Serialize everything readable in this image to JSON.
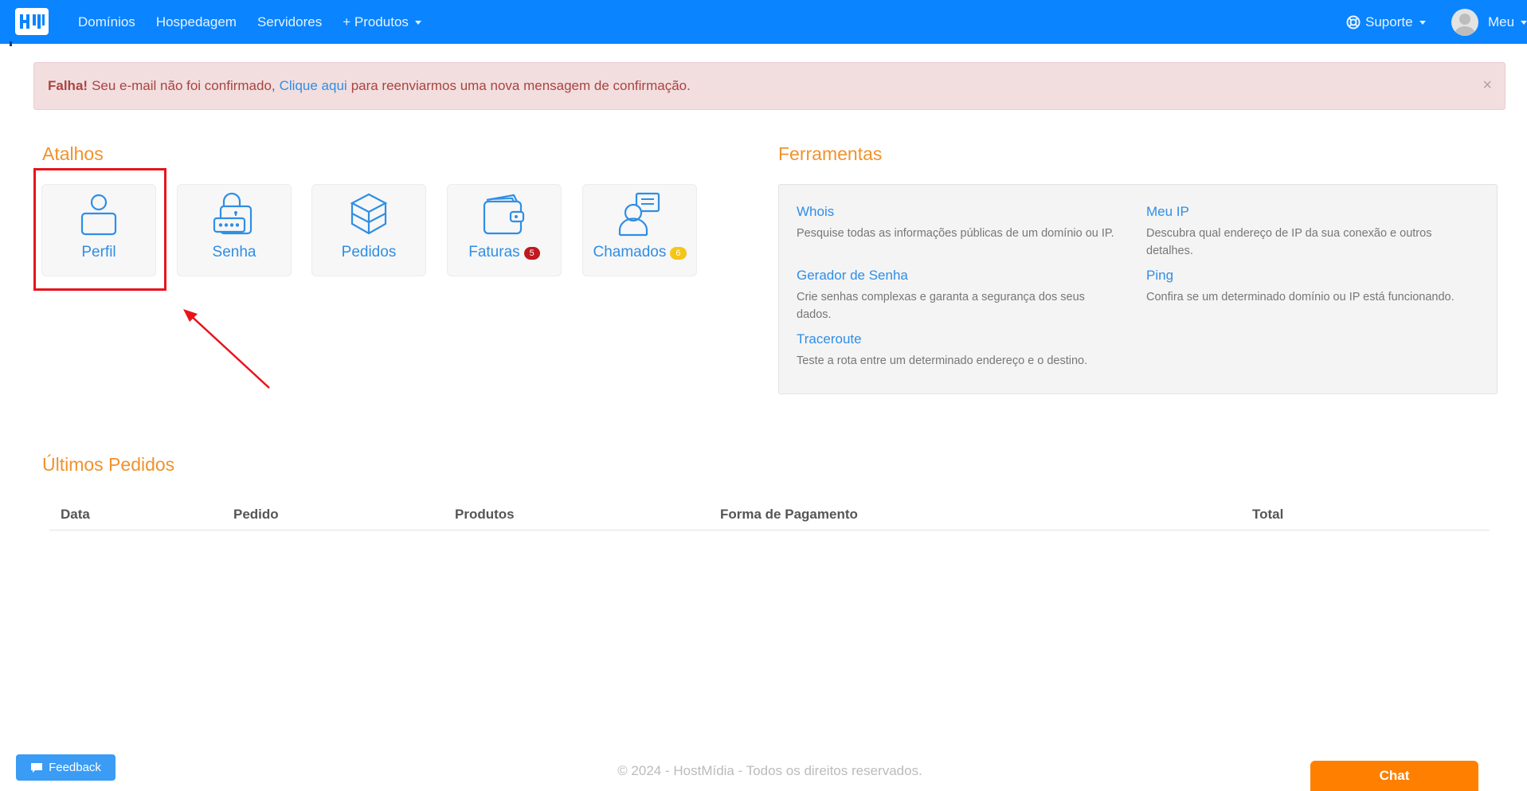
{
  "header": {
    "nav": [
      {
        "label": "Domínios"
      },
      {
        "label": "Hospedagem"
      },
      {
        "label": "Servidores"
      },
      {
        "label": "+ Produtos"
      }
    ],
    "support_label": "Suporte",
    "user_label": "Meu"
  },
  "alert": {
    "strong": "Falha!",
    "text_before": "Seu e-mail não foi confirmado,",
    "link": "Clique aqui",
    "text_after": "para reenviarmos uma nova mensagem de confirmação.",
    "close": "×"
  },
  "shortcuts": {
    "title": "Atalhos",
    "items": [
      {
        "label": "Perfil",
        "icon": "user-icon"
      },
      {
        "label": "Senha",
        "icon": "lock-icon"
      },
      {
        "label": "Pedidos",
        "icon": "box-icon"
      },
      {
        "label": "Faturas",
        "icon": "wallet-icon",
        "badge": "5",
        "badge_color": "#c0191f"
      },
      {
        "label": "Chamados",
        "icon": "support-ticket-icon",
        "badge": "6",
        "badge_color": "#f5c518"
      }
    ]
  },
  "tools": {
    "title": "Ferramentas",
    "items": [
      {
        "title": "Whois",
        "desc": "Pesquise todas as informações públicas de um domínio ou IP."
      },
      {
        "title": "Meu IP",
        "desc": "Descubra qual endereço de IP da sua conexão e outros detalhes."
      },
      {
        "title": "Gerador de Senha",
        "desc": "Crie senhas complexas e garanta a segurança dos seus dados."
      },
      {
        "title": "Ping",
        "desc": "Confira se um determinado domínio ou IP está funcionando."
      },
      {
        "title": "Traceroute",
        "desc": "Teste a rota entre um determinado endereço e o destino."
      }
    ]
  },
  "orders": {
    "title": "Últimos Pedidos",
    "columns": [
      "Data",
      "Pedido",
      "Produtos",
      "Forma de Pagamento",
      "Total"
    ]
  },
  "footer": "© 2024 - HostMídia - Todos os direitos reservados.",
  "feedback_label": "Feedback",
  "chat_label": "Chat",
  "colors": {
    "accent": "#0a84ff",
    "orange": "#f0922d",
    "link": "#2f8ee6",
    "highlight": "#e8141c"
  }
}
